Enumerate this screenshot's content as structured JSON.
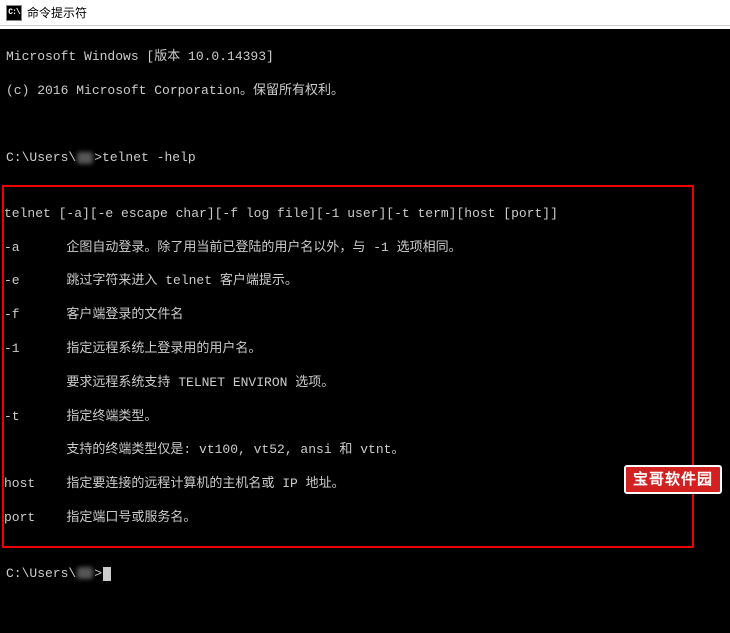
{
  "titlebar": {
    "icon_text": "C:\\",
    "title": "命令提示符"
  },
  "terminal": {
    "version_line": "Microsoft Windows [版本 10.0.14393]",
    "copyright_line": "(c) 2016 Microsoft Corporation。保留所有权利。",
    "prompt_prefix": "C:\\Users\\",
    "prompt_suffix": ">",
    "command": "telnet -help",
    "help": {
      "usage": "telnet [-a][-e escape char][-f log file][-1 user][-t term][host [port]]",
      "opt_a": "-a      企图自动登录。除了用当前已登陆的用户名以外，与 -1 选项相同。",
      "opt_e": "-e      跳过字符来进入 telnet 客户端提示。",
      "opt_f": "-f      客户端登录的文件名",
      "opt_1": "-1      指定远程系统上登录用的用户名。",
      "opt_1b": "        要求远程系统支持 TELNET ENVIRON 选项。",
      "opt_t": "-t      指定终端类型。",
      "opt_tb": "        支持的终端类型仅是: vt100, vt52, ansi 和 vtnt。",
      "opt_host": "host    指定要连接的远程计算机的主机名或 IP 地址。",
      "opt_port": "port    指定端口号或服务名。"
    }
  },
  "watermark": "宝哥软件园"
}
